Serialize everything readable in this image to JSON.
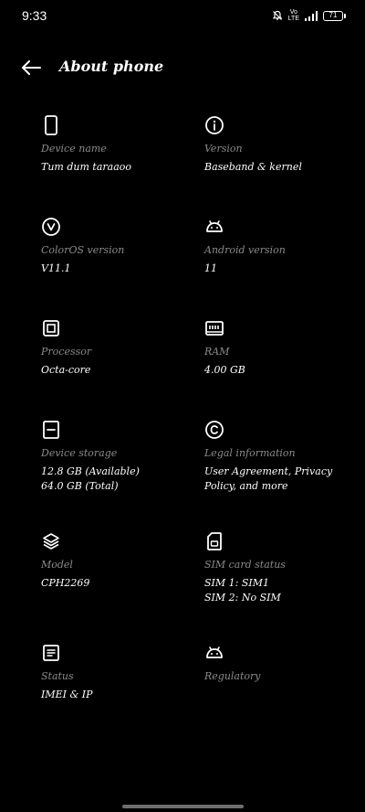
{
  "status_bar": {
    "time": "9:33",
    "volte_top": "Vo",
    "volte_bottom": "LTE",
    "battery": "71"
  },
  "header": {
    "title": "About phone"
  },
  "items": [
    {
      "label": "Device name",
      "value": "Tum dum taraaoo"
    },
    {
      "label": "Version",
      "value": "Baseband & kernel"
    },
    {
      "label": "ColorOS version",
      "value": "V11.1"
    },
    {
      "label": "Android version",
      "value": "11"
    },
    {
      "label": "Processor",
      "value": "Octa-core"
    },
    {
      "label": "RAM",
      "value": "4.00 GB"
    },
    {
      "label": "Device storage",
      "value": "12.8 GB (Available)\n64.0 GB (Total)"
    },
    {
      "label": "Legal information",
      "value": "User Agreement, Privacy\nPolicy, and more"
    },
    {
      "label": "Model",
      "value": "CPH2269"
    },
    {
      "label": "SIM card status",
      "value": "SIM 1: SIM1\nSIM 2: No SIM"
    },
    {
      "label": "Status",
      "value": "IMEI & IP"
    },
    {
      "label": "Regulatory",
      "value": ""
    }
  ],
  "icons": {
    "device_name": "phone-icon",
    "version": "info-icon",
    "coloros": "coloros-v-icon",
    "android": "android-icon",
    "processor": "chip-icon",
    "ram": "ram-icon",
    "storage": "storage-icon",
    "legal": "copyright-icon",
    "model": "layers-icon",
    "sim": "sim-card-icon",
    "status": "document-icon",
    "regulatory": "android-icon"
  }
}
